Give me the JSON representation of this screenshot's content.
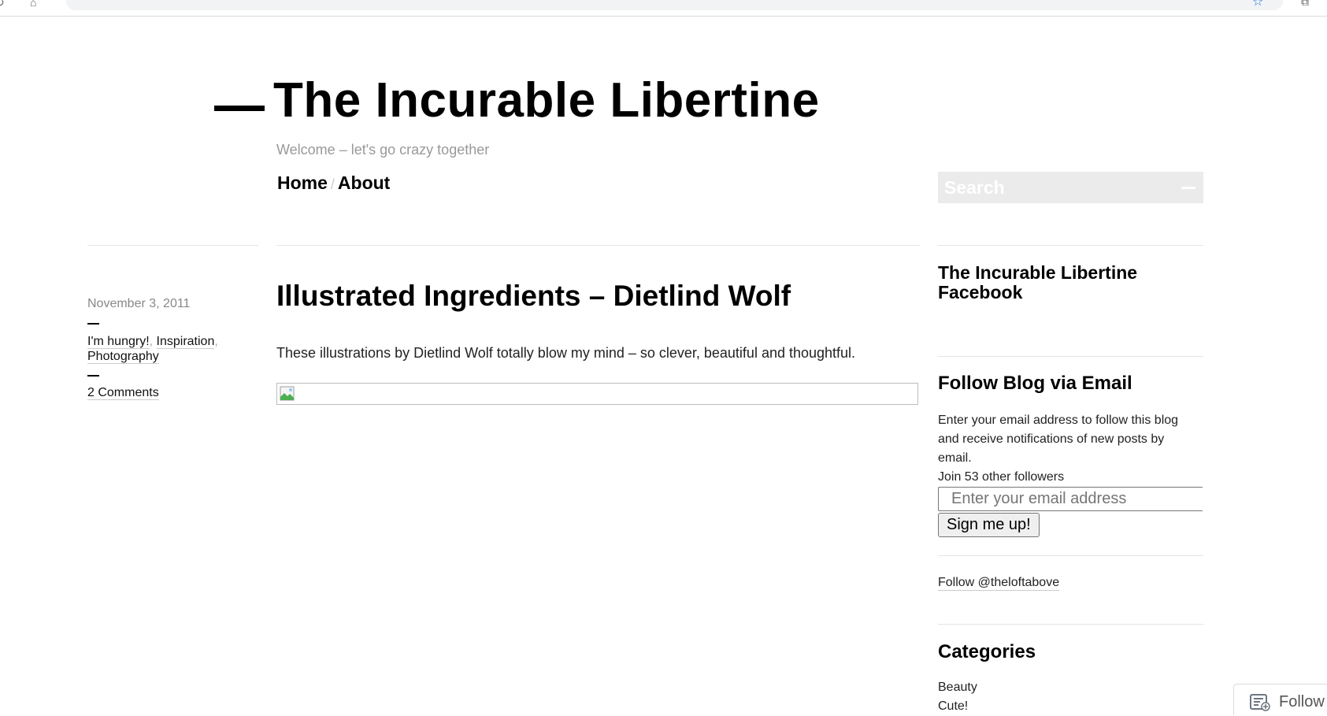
{
  "site": {
    "title": "The Incurable Libertine",
    "tagline": "Welcome – let's go crazy together"
  },
  "nav": {
    "items": [
      {
        "label": "Home"
      },
      {
        "label": "About"
      }
    ],
    "separator": "/"
  },
  "search": {
    "placeholder": "Search"
  },
  "post": {
    "date": "November 3, 2011",
    "categories": [
      "I'm hungry!",
      "Inspiration",
      "Photography"
    ],
    "comments": "2 Comments",
    "title": "Illustrated Ingredients – Dietlind Wolf",
    "body": "These illustrations by Dietlind Wolf totally blow my mind – so clever, beautiful and thoughtful."
  },
  "sidebar": {
    "facebook_title": "The Incurable Libertine Facebook",
    "follow_email": {
      "title": "Follow Blog via Email",
      "description": "Enter your email address to follow this blog and receive notifications of new posts by email.",
      "followers": "Join 53 other followers",
      "email_placeholder": "Enter your email address",
      "button_label": "Sign me up!"
    },
    "twitter_link": "Follow @theloftabove",
    "categories": {
      "title": "Categories",
      "items": [
        "Beauty",
        "Cute!"
      ]
    }
  },
  "follow_button": {
    "label": "Follow"
  },
  "colors": {
    "title": "#000000",
    "muted": "#999999",
    "search_bg": "#ebebeb",
    "rule": "#e4e4e4"
  }
}
